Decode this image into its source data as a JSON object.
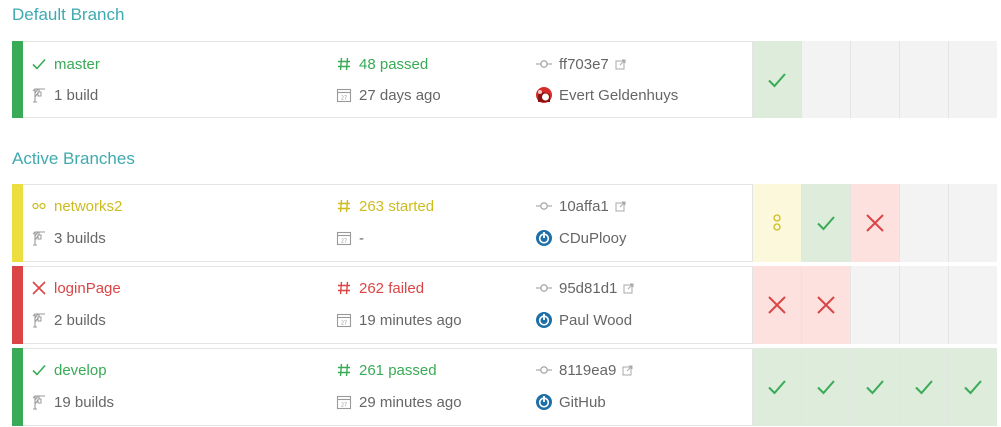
{
  "sections": {
    "default_title": "Default Branch",
    "active_title": "Active Branches"
  },
  "branches": [
    {
      "name": "master",
      "state": "passed",
      "builds": "1 build",
      "build_status": "# 48 passed",
      "build_number": "48 passed",
      "when": "27 days ago",
      "commit": "ff703e7",
      "author": "Evert Geldenhuys",
      "author_icon": "avatar-red",
      "history": [
        "passed",
        "empty",
        "empty",
        "empty",
        "empty"
      ]
    },
    {
      "name": "networks2",
      "state": "started",
      "builds": "3 builds",
      "build_number": "263 started",
      "when": "-",
      "commit": "10affa1",
      "author": "CDuPlooy",
      "author_icon": "github-power-icon",
      "history": [
        "started",
        "passed",
        "failed",
        "none",
        "none"
      ]
    },
    {
      "name": "loginPage",
      "state": "failed",
      "builds": "2 builds",
      "build_number": "262 failed",
      "when": "19 minutes ago",
      "commit": "95d81d1",
      "author": "Paul Wood",
      "author_icon": "github-power-icon",
      "history": [
        "failed",
        "failed",
        "empty",
        "empty",
        "empty"
      ]
    },
    {
      "name": "develop",
      "state": "passed",
      "builds": "19 builds",
      "build_number": "261 passed",
      "when": "29 minutes ago",
      "commit": "8119ea9",
      "author": "GitHub",
      "author_icon": "github-power-icon",
      "history": [
        "passed",
        "passed",
        "passed",
        "passed",
        "passed"
      ]
    }
  ],
  "colors": {
    "passed": "#39aa56",
    "started": "#cdbc1f",
    "failed": "#db4545",
    "title": "#3eaaaf"
  }
}
